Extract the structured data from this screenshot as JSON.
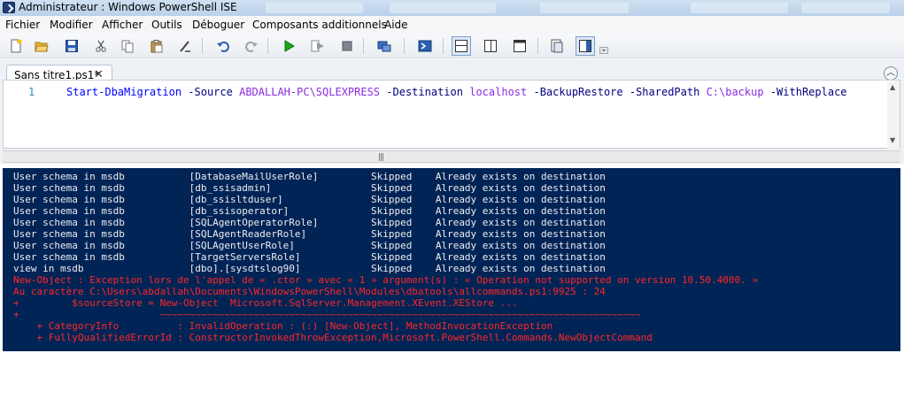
{
  "window": {
    "title": "Administrateur : Windows PowerShell ISE"
  },
  "menu": [
    "Fichier",
    "Modifier",
    "Afficher",
    "Outils",
    "Déboguer",
    "Composants additionnels",
    "Aide"
  ],
  "toolbar": {
    "icons": [
      "new-icon",
      "open-icon",
      "save-icon",
      "cut-icon",
      "copy-icon",
      "paste-icon",
      "clear-icon",
      "undo-icon",
      "redo-icon",
      "run-icon",
      "run-selection-icon",
      "stop-icon",
      "remote-tab-icon",
      "powershell-icon",
      "layout-top-icon",
      "layout-right-icon",
      "layout-max-icon",
      "snippet-icon",
      "commands-icon"
    ]
  },
  "editor": {
    "tab_label": "Sans titre1.ps1*",
    "line_number": "1",
    "code": {
      "cmd": "Start-DbaMigration",
      "p1": "-Source",
      "v1": "ABDALLAH-PC\\SQLEXPRESS",
      "p2": "-Destination",
      "v2": "localhost",
      "p3": "-BackupRestore -SharedPath",
      "v3": "C:\\backup",
      "p4": "-WithReplace"
    }
  },
  "console": {
    "lines": [
      {
        "text": "User schema in msdb           [DatabaseMailUserRole]         Skipped    Already exists on destination",
        "kind": "out"
      },
      {
        "text": "User schema in msdb           [db_ssisadmin]                 Skipped    Already exists on destination",
        "kind": "out"
      },
      {
        "text": "User schema in msdb           [db_ssisltduser]               Skipped    Already exists on destination",
        "kind": "out"
      },
      {
        "text": "User schema in msdb           [db_ssisoperator]              Skipped    Already exists on destination",
        "kind": "out"
      },
      {
        "text": "User schema in msdb           [SQLAgentOperatorRole]         Skipped    Already exists on destination",
        "kind": "out"
      },
      {
        "text": "User schema in msdb           [SQLAgentReaderRole]           Skipped    Already exists on destination",
        "kind": "out"
      },
      {
        "text": "User schema in msdb           [SQLAgentUserRole]             Skipped    Already exists on destination",
        "kind": "out"
      },
      {
        "text": "User schema in msdb           [TargetServersRole]            Skipped    Already exists on destination",
        "kind": "out"
      },
      {
        "text": "view in msdb                  [dbo].[sysdtslog90]            Skipped    Already exists on destination",
        "kind": "out"
      },
      {
        "text": "New-Object : Exception lors de l'appel de « .ctor » avec « 1 » argument(s) : « Operation not supported on version 10.50.4000. »",
        "kind": "err"
      },
      {
        "text": "Au caractère C:\\Users\\abdallah\\Documents\\WindowsPowerShell\\Modules\\dbatools\\allcommands.ps1:9925 : 24",
        "kind": "err"
      },
      {
        "text": "+         $sourceStore = New-Object  Microsoft.SqlServer.Management.XEvent.XEStore ...",
        "kind": "err"
      },
      {
        "text": "+                        ~~~~~~~~~~~~~~~~~~~~~~~~~~~~~~~~~~~~~~~~~~~~~~~~~~~~~~~~~~~~~~~~~~~~~~~~~~~~~~~~~~",
        "kind": "err"
      },
      {
        "text": "    + CategoryInfo          : InvalidOperation : (:) [New-Object], MethodInvocationException",
        "kind": "err"
      },
      {
        "text": "    + FullyQualifiedErrorId : ConstructorInvokedThrowException,Microsoft.PowerShell.Commands.NewObjectCommand",
        "kind": "err"
      }
    ]
  }
}
